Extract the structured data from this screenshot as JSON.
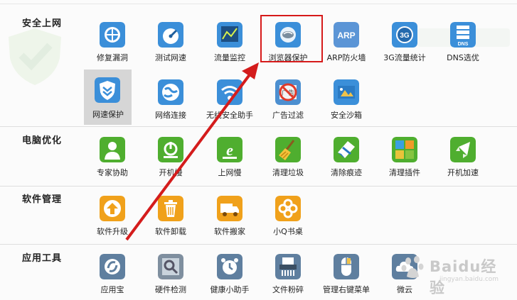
{
  "sections": [
    {
      "title": "安全上网"
    },
    {
      "title": "电脑优化"
    },
    {
      "title": "软件管理"
    },
    {
      "title": "应用工具"
    }
  ],
  "tools": {
    "repair": "修复漏洞",
    "speedtest": "测试网速",
    "traffic": "流量监控",
    "browser": "浏览器保护",
    "arp": "ARP防火墙",
    "g3": "3G流量统计",
    "dns": "DNS选优",
    "netprotect": "网速保护",
    "netconnect": "网络连接",
    "wifi": "无线安全助手",
    "adfilter": "广告过滤",
    "sandbox": "安全沙箱",
    "expert": "专家协助",
    "bootslow": "开机慢",
    "webslow": "上网慢",
    "junk": "清理垃圾",
    "traces": "清除痕迹",
    "plugins": "清理插件",
    "bootspeed": "开机加速",
    "upgrade": "软件升级",
    "uninstall": "软件卸载",
    "move": "软件搬家",
    "xiaoq": "小Q书桌",
    "appbao": "应用宝",
    "hwcheck": "硬件检测",
    "health": "健康小助手",
    "shred": "文件粉碎",
    "rightmenu": "管理右键菜单",
    "weiyun": "微云"
  },
  "icon_text": {
    "arp": "ARP",
    "g3": "3G",
    "dns": "DNS",
    "ad": "广告"
  },
  "watermark": {
    "main": "Baidu经验",
    "sub": "jingyan.baidu.com"
  },
  "colors": {
    "blue": "#3a8fd8",
    "green": "#4fae2f",
    "orange": "#f0a11b",
    "steel": "#5f7f9f",
    "highlight": "#d61a1a"
  }
}
